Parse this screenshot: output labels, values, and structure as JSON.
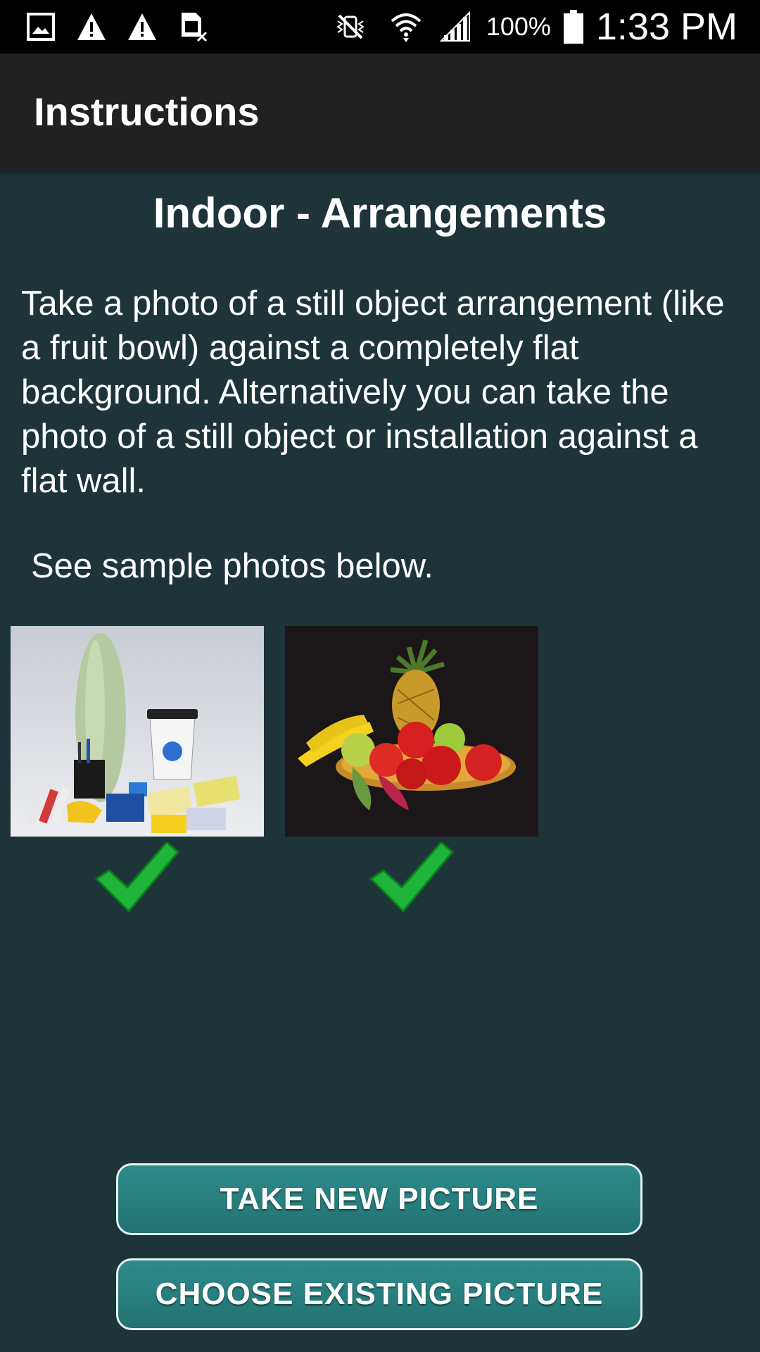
{
  "status_bar": {
    "left_icons": [
      "gallery-icon",
      "warning-icon",
      "warning-icon",
      "sim-card-icon"
    ],
    "right_icons": [
      "vibrate-icon",
      "wifi-icon",
      "signal-icon",
      "battery-icon"
    ],
    "battery": "100%",
    "time": "1:33 PM"
  },
  "app_bar": {
    "title": "Instructions"
  },
  "content": {
    "heading": "Indoor - Arrangements",
    "description": "Take a photo of a still object arrangement (like a fruit bowl) against a completely flat background. Alternatively you can take the photo of a still object or installation against a flat wall.",
    "sample_note": "See sample photos below.",
    "samples": [
      {
        "subject": "still-life objects arrangement",
        "approved": true
      },
      {
        "subject": "fruit bowl arrangement",
        "approved": true
      }
    ]
  },
  "buttons": {
    "take_new": "TAKE NEW PICTURE",
    "choose_existing": "CHOOSE EXISTING PICTURE"
  },
  "colors": {
    "background": "#1d3438",
    "app_bar": "#212121",
    "button": "#2a7e7e",
    "check": "#1fb43a"
  }
}
